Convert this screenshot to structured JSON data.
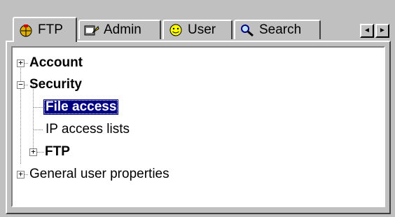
{
  "tabs": [
    {
      "label": "FTP",
      "icon": "ftp-globe-icon",
      "active": true
    },
    {
      "label": "Admin",
      "icon": "admin-key-icon",
      "active": false
    },
    {
      "label": "User",
      "icon": "user-smiley-icon",
      "active": false
    },
    {
      "label": "Search",
      "icon": "search-magnifier-icon",
      "active": false
    }
  ],
  "scroll": {
    "left": "◄",
    "right": "►"
  },
  "tree": {
    "account": {
      "label": "Account",
      "expander": "+"
    },
    "security": {
      "label": "Security",
      "expander": "−"
    },
    "file_access": {
      "label": "File access"
    },
    "ip_access": {
      "label": "IP access lists"
    },
    "ftp": {
      "label": "FTP",
      "expander": "+"
    },
    "general": {
      "label": "General user properties",
      "expander": "+"
    }
  },
  "colors": {
    "selection": "#000080",
    "face": "#c0c0c0"
  }
}
